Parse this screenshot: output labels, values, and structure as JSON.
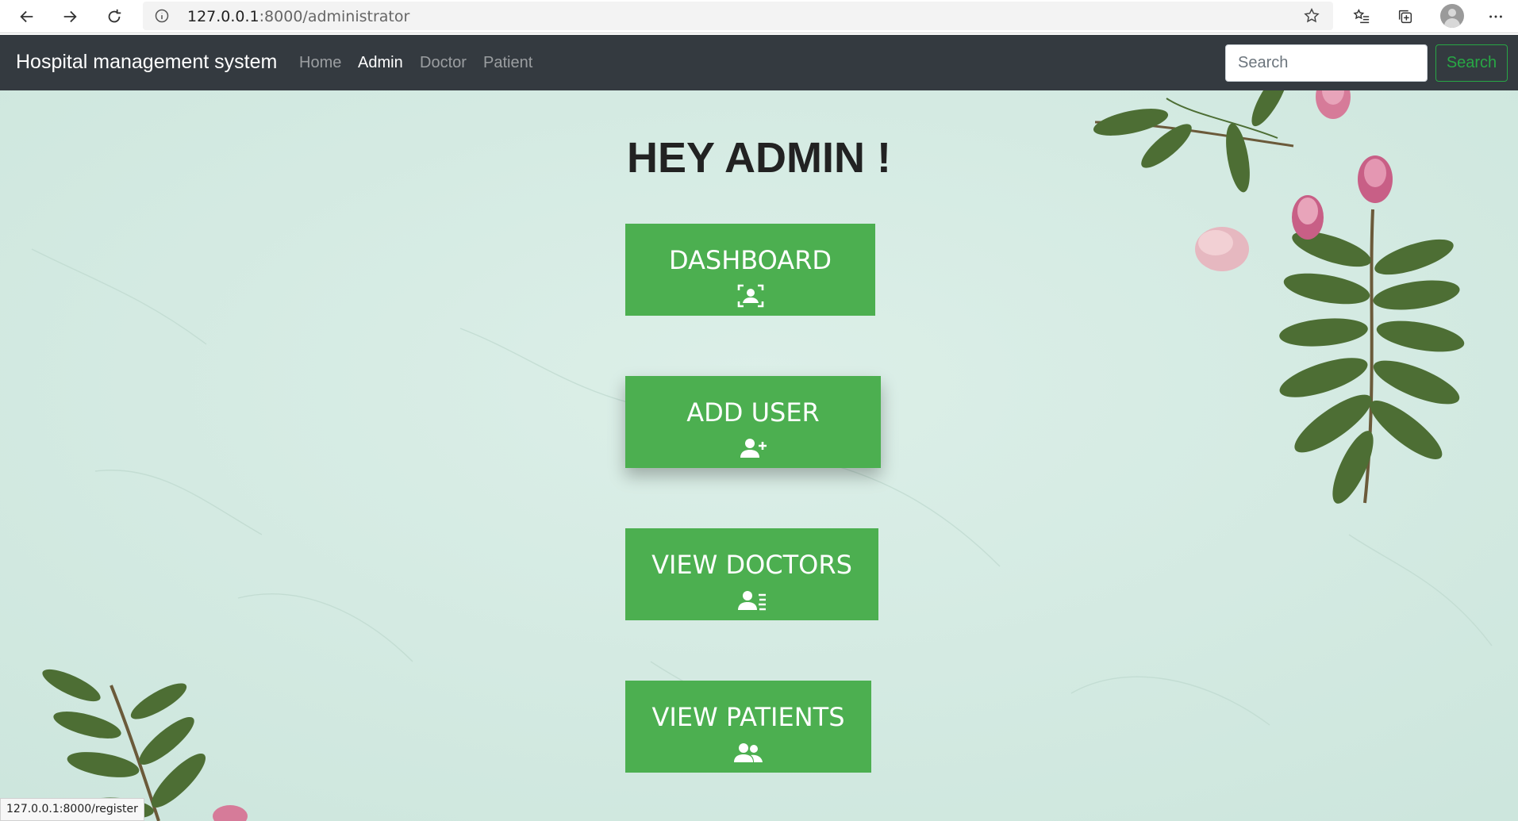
{
  "browser": {
    "url_host": "127.0.0.1",
    "url_path": ":8000/administrator",
    "status_url": "127.0.0.1:8000/register"
  },
  "navbar": {
    "brand": "Hospital management system",
    "links": [
      {
        "label": "Home",
        "active": false
      },
      {
        "label": "Admin",
        "active": true
      },
      {
        "label": "Doctor",
        "active": false
      },
      {
        "label": "Patient",
        "active": false
      }
    ],
    "search": {
      "placeholder": "Search",
      "button_label": "Search"
    }
  },
  "main": {
    "heading": "HEY ADMIN !",
    "buttons": [
      {
        "label": "DASHBOARD",
        "icon": "user-scan-icon"
      },
      {
        "label": "ADD USER",
        "icon": "user-plus-icon"
      },
      {
        "label": "VIEW DOCTORS",
        "icon": "user-list-icon"
      },
      {
        "label": "VIEW PATIENTS",
        "icon": "users-icon"
      }
    ]
  },
  "colors": {
    "navbar": "#343a40",
    "accent_green": "#4caf50",
    "search_outline": "#28a745",
    "background": "#d4ebe3"
  }
}
